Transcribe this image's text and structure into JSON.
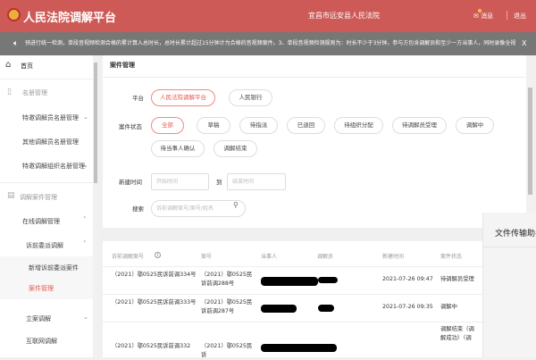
{
  "header": {
    "title": "人民法院调解平台",
    "court": "宜昌市远安县人民法院",
    "messages": "消息",
    "logout": "退出"
  },
  "notice": {
    "text": "预进行统一检测，单段音视频检测合格的累计算入总时长，总时长累计超过15分钟计为合格的音视频案件。3、单段音视频检测规则为：时长不少于3分钟，参与方包含调解员和至少一方当事人，同时录像全视",
    "close": "X"
  },
  "sidebar": {
    "items": [
      {
        "label": "首页",
        "icon": "home-icon"
      },
      {
        "label": "名册管理",
        "icon": "roster-icon"
      },
      {
        "label": "特邀调解员名册管理",
        "chevron": "down"
      },
      {
        "label": "其他调解员名册管理"
      },
      {
        "label": "特邀调解组织名册管理",
        "chevron": "down"
      },
      {
        "label": "调解案件管理",
        "icon": "document-icon"
      },
      {
        "label": "在线调解管理",
        "chevron": "up"
      },
      {
        "label": "诉前委派调解",
        "chevron": "up"
      },
      {
        "label": "新增诉前委派案件"
      },
      {
        "label": "案件管理",
        "active": true
      },
      {
        "label": "立案调解",
        "chevron": "down"
      },
      {
        "label": "互联网调解"
      }
    ]
  },
  "main": {
    "title": "案件管理",
    "platform_label": "平台",
    "platforms": [
      "人民法院调解平台",
      "人民银行"
    ],
    "status_label": "案件状态",
    "statuses": [
      "全部",
      "草稿",
      "待指派",
      "已退回",
      "待组织分配",
      "待调解员受理",
      "调解中",
      "待当事人确认",
      "调解结束"
    ],
    "created_label": "新建时间",
    "start_placeholder": "开始时间",
    "to": "到",
    "end_placeholder": "结束时间",
    "search_label": "搜索",
    "search_placeholder": "诉前调解案号/案号/姓名"
  },
  "table": {
    "columns": [
      "诉前调解案号",
      "案号",
      "当事人",
      "调解员",
      "新建时间",
      "案件状态"
    ],
    "rows": [
      {
        "pre_no": "（2021）鄂0525民诉前调334号",
        "case_no": "（2021）鄂0525民诉前调288号",
        "time": "2021-07-26 09:47",
        "status": "待调解员受理"
      },
      {
        "pre_no": "（2021）鄂0525民诉前调333号",
        "case_no": "（2021）鄂0525民诉前调287号",
        "time": "2021-07-26 09:35",
        "status": "调解中"
      },
      {
        "pre_no": "（2021）鄂0525民诉前调332",
        "case_no": "（2021）鄂0525民诉",
        "time": "",
        "status": "调解结束（调解成功）（调"
      }
    ]
  },
  "overlay": {
    "title": "文件传输助手"
  },
  "colors": {
    "brand": "#cd5a56",
    "accent": "#e8574d",
    "notice_bg": "#777777"
  }
}
